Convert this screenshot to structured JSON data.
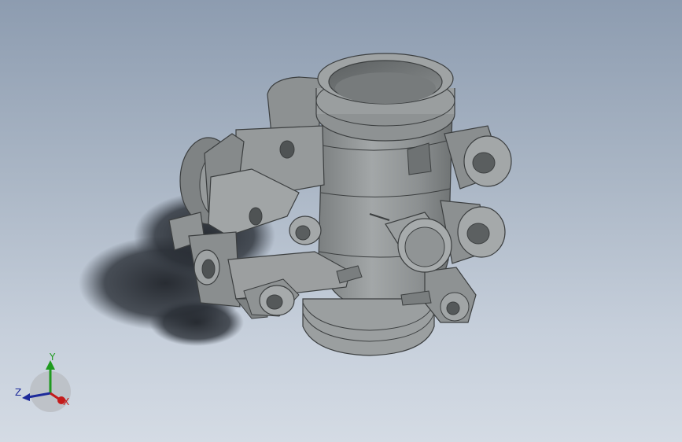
{
  "viewport": {
    "background_top": "#8d9cb0",
    "background_bottom": "#d4dbe4",
    "model_color": "#8e9293"
  },
  "triad": {
    "axes": {
      "x": {
        "label": "X",
        "color": "#c41a1a"
      },
      "y": {
        "label": "Y",
        "color": "#1f9a1f"
      },
      "z": {
        "label": "Z",
        "color": "#1d2a9a"
      }
    }
  }
}
